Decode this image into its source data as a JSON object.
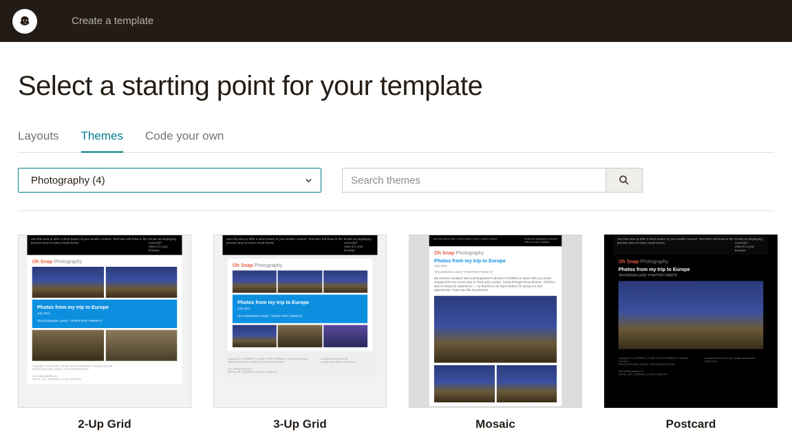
{
  "header": {
    "title": "Create a template"
  },
  "page": {
    "title": "Select a starting point for your template"
  },
  "tabs": [
    {
      "label": "Layouts",
      "active": false
    },
    {
      "label": "Themes",
      "active": true
    },
    {
      "label": "Code your own",
      "active": false
    }
  ],
  "dropdown": {
    "selected": "Photography (4)"
  },
  "search": {
    "placeholder": "Search themes"
  },
  "templates": [
    {
      "name": "2-Up Grid"
    },
    {
      "name": "3-Up Grid"
    },
    {
      "name": "Mosaic"
    },
    {
      "name": "Postcard"
    }
  ],
  "preview": {
    "brand": "Oh Snap",
    "brand_sub": "Photography",
    "headline": "Photos from my trip to Europe",
    "date": "July 2011",
    "social": "*|FACEBOOK:LIKE|* *|TWITTER:TWEET|*",
    "blurb": "My summer vacation was a photographer's dream! I'm thrilled to share with you some images from my recent trips to Paris and London. Going through these photos, I felt like I was re-living the experience — so thanks to my loyal readers for giving me that opportunity! I hope you like my pictures."
  }
}
